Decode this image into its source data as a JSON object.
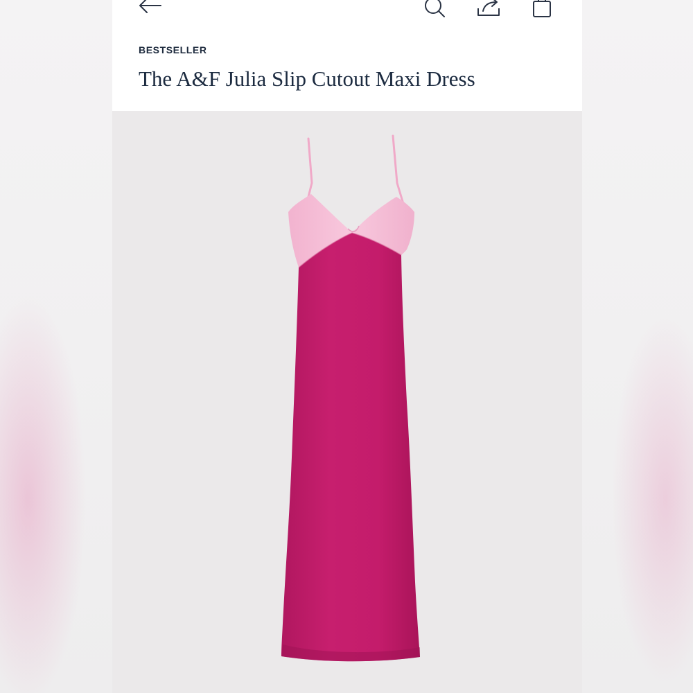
{
  "header": {
    "icons": [
      "back-arrow-icon",
      "search-icon",
      "share-icon",
      "shopping-bag-icon"
    ]
  },
  "product": {
    "badge": "BESTSELLER",
    "title": "The A&F Julia Slip Cutout Maxi Dress",
    "image": {
      "subject": "slip-maxi-dress-icon",
      "colors": {
        "bodice": "#f4b8d2",
        "skirt": "#c51d6c",
        "background": "#ebe9ea"
      }
    }
  }
}
